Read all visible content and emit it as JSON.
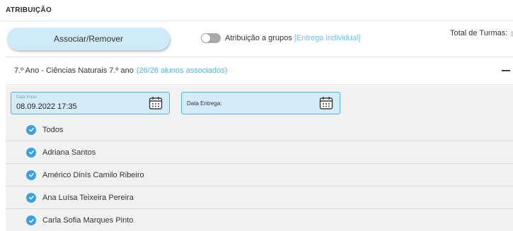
{
  "section": {
    "title": "ATRIBUIÇÃO"
  },
  "actions": {
    "associate_button": "Associar/Remover",
    "group_toggle_label": "Atribuição a grupos",
    "group_toggle_hint": "[Entrega individual]",
    "total_label": "Total de Turmas:"
  },
  "class_group": {
    "title": "7.º Ano - Ciências Naturais 7.º ano",
    "association_count": "(26/26 alunos associados)"
  },
  "dates": {
    "start_label": "Data Início",
    "start_value": "08.09.2022 17:35",
    "end_label": "Data Entrega:"
  },
  "students": [
    {
      "name": "Todos",
      "checked": true
    },
    {
      "name": "Adriana Santos",
      "checked": true
    },
    {
      "name": "Américo Dinís Camilo Ribeiro",
      "checked": true
    },
    {
      "name": "Ana Luísa Teixeira Pereira",
      "checked": true
    },
    {
      "name": "Carla Sofia Marques Pinto",
      "checked": true
    }
  ],
  "colors": {
    "accent": "#3aa2e0",
    "button_bg": "#cfeaf8",
    "date_border": "#58aee0"
  }
}
